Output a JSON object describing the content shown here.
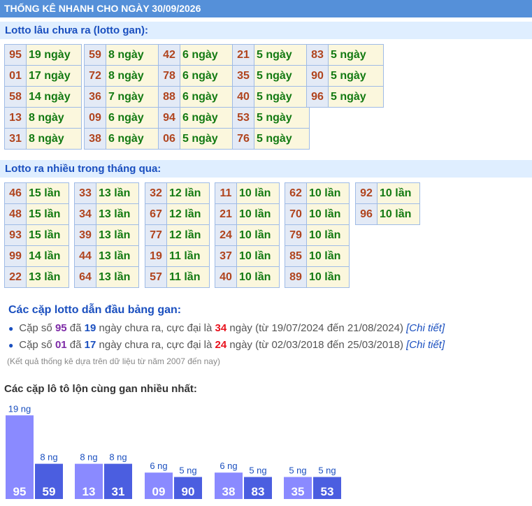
{
  "header": {
    "title": "THỐNG KÊ NHANH CHO NGÀY 30/09/2026"
  },
  "gan": {
    "title": "Lotto lâu chưa ra (lotto gan):",
    "columns": [
      [
        {
          "num": "95",
          "val": "19 ngày"
        },
        {
          "num": "01",
          "val": "17 ngày"
        },
        {
          "num": "58",
          "val": "14 ngày"
        },
        {
          "num": "13",
          "val": "8 ngày"
        },
        {
          "num": "31",
          "val": "8 ngày"
        }
      ],
      [
        {
          "num": "59",
          "val": "8 ngày"
        },
        {
          "num": "72",
          "val": "8 ngày"
        },
        {
          "num": "36",
          "val": "7 ngày"
        },
        {
          "num": "09",
          "val": "6 ngày"
        },
        {
          "num": "38",
          "val": "6 ngày"
        }
      ],
      [
        {
          "num": "42",
          "val": "6 ngày"
        },
        {
          "num": "78",
          "val": "6 ngày"
        },
        {
          "num": "88",
          "val": "6 ngày"
        },
        {
          "num": "94",
          "val": "6 ngày"
        },
        {
          "num": "06",
          "val": "5 ngày"
        }
      ],
      [
        {
          "num": "21",
          "val": "5 ngày"
        },
        {
          "num": "35",
          "val": "5 ngày"
        },
        {
          "num": "40",
          "val": "5 ngày"
        },
        {
          "num": "53",
          "val": "5 ngày"
        },
        {
          "num": "76",
          "val": "5 ngày"
        }
      ],
      [
        {
          "num": "83",
          "val": "5 ngày"
        },
        {
          "num": "90",
          "val": "5 ngày"
        },
        {
          "num": "96",
          "val": "5 ngày"
        }
      ]
    ]
  },
  "frequent": {
    "title": "Lotto ra nhiều trong tháng qua:",
    "columns": [
      [
        {
          "num": "46",
          "val": "15 lần"
        },
        {
          "num": "48",
          "val": "15 lần"
        },
        {
          "num": "93",
          "val": "15 lần"
        },
        {
          "num": "99",
          "val": "14 lần"
        },
        {
          "num": "22",
          "val": "13 lần"
        }
      ],
      [
        {
          "num": "33",
          "val": "13 lần"
        },
        {
          "num": "34",
          "val": "13 lần"
        },
        {
          "num": "39",
          "val": "13 lần"
        },
        {
          "num": "44",
          "val": "13 lần"
        },
        {
          "num": "64",
          "val": "13 lần"
        }
      ],
      [
        {
          "num": "32",
          "val": "12 lần"
        },
        {
          "num": "67",
          "val": "12 lần"
        },
        {
          "num": "77",
          "val": "12 lần"
        },
        {
          "num": "19",
          "val": "11 lần"
        },
        {
          "num": "57",
          "val": "11 lần"
        }
      ],
      [
        {
          "num": "11",
          "val": "10 lần"
        },
        {
          "num": "21",
          "val": "10 lần"
        },
        {
          "num": "24",
          "val": "10 lần"
        },
        {
          "num": "37",
          "val": "10 lần"
        },
        {
          "num": "40",
          "val": "10 lần"
        }
      ],
      [
        {
          "num": "62",
          "val": "10 lần"
        },
        {
          "num": "70",
          "val": "10 lần"
        },
        {
          "num": "79",
          "val": "10 lần"
        },
        {
          "num": "85",
          "val": "10 lần"
        },
        {
          "num": "89",
          "val": "10 lần"
        }
      ],
      [
        {
          "num": "92",
          "val": "10 lần"
        },
        {
          "num": "96",
          "val": "10 lần"
        }
      ]
    ]
  },
  "leaders": {
    "title": "Các cặp lotto dẫn đầu bảng gan:",
    "items": [
      {
        "t1": "Cặp số ",
        "pair": "01",
        "t2": " đã ",
        "days": "17",
        "t3": " ngày chưa ra, cực đại là ",
        "max": "24",
        "t4": " ngày (từ 02/03/2018 đến 25/03/2018) ",
        "link": "[Chi tiết]"
      }
    ],
    "first": {
      "t1": "Cặp số ",
      "pair": "95",
      "t2": " đã ",
      "days": "19",
      "t3": " ngày chưa ra, cực đại là ",
      "max": "34",
      "t4": " ngày (từ 19/07/2024 đến 21/08/2024) ",
      "link": "[Chi tiết]"
    },
    "bullet": "●"
  },
  "note": "(Kết quả thống kê dựa trên dữ liệu từ năm 2007 đến nay)",
  "pairs_title": "Các cặp lô tô lộn cùng gan nhiều nhất:",
  "chart_data": {
    "type": "bar",
    "unit_suffix": " ng",
    "pairs": [
      [
        {
          "num": "95",
          "days": 19
        },
        {
          "num": "59",
          "days": 8
        }
      ],
      [
        {
          "num": "13",
          "days": 8
        },
        {
          "num": "31",
          "days": 8
        }
      ],
      [
        {
          "num": "09",
          "days": 6
        },
        {
          "num": "90",
          "days": 5
        }
      ],
      [
        {
          "num": "38",
          "days": 6
        },
        {
          "num": "83",
          "days": 5
        }
      ],
      [
        {
          "num": "35",
          "days": 5
        },
        {
          "num": "53",
          "days": 5
        }
      ]
    ],
    "colors": {
      "first": "#8a8aff",
      "second": "#4b5ee0",
      "label": "#1a4fbf"
    }
  }
}
